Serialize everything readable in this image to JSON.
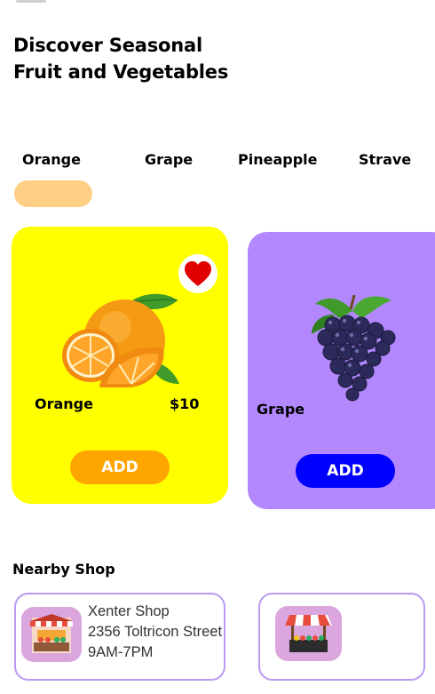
{
  "header": {
    "title_line1": "Discover Seasonal",
    "title_line2": "Fruit and Vegetables"
  },
  "tabs": [
    {
      "label": "Orange",
      "selected": true
    },
    {
      "label": "Grape",
      "selected": false
    },
    {
      "label": "Pineapple",
      "selected": false
    },
    {
      "label": "Strave",
      "selected": false
    }
  ],
  "products": [
    {
      "name": "Orange",
      "price": "$10",
      "button": "ADD",
      "favorite": true,
      "icon": "orange-fruit-image"
    },
    {
      "name": "Grape",
      "button": "ADD",
      "icon": "grape-fruit-image"
    }
  ],
  "nearby": {
    "title": "Nearby Shop",
    "shops": [
      {
        "name": "Xenter Shop",
        "address": "2356 Toltricon Street",
        "hours": "9AM-7PM",
        "icon": "market-stall-image"
      },
      {
        "icon": "market-stall-image"
      }
    ]
  },
  "colors": {
    "orange_card": "#ffff00",
    "grape_card": "#b388ff",
    "orange_button": "#ffa500",
    "grape_button": "#0000ff",
    "tab_indicator": "#ffcf86",
    "heart": "#e00000",
    "shop_border": "#b99af0"
  }
}
